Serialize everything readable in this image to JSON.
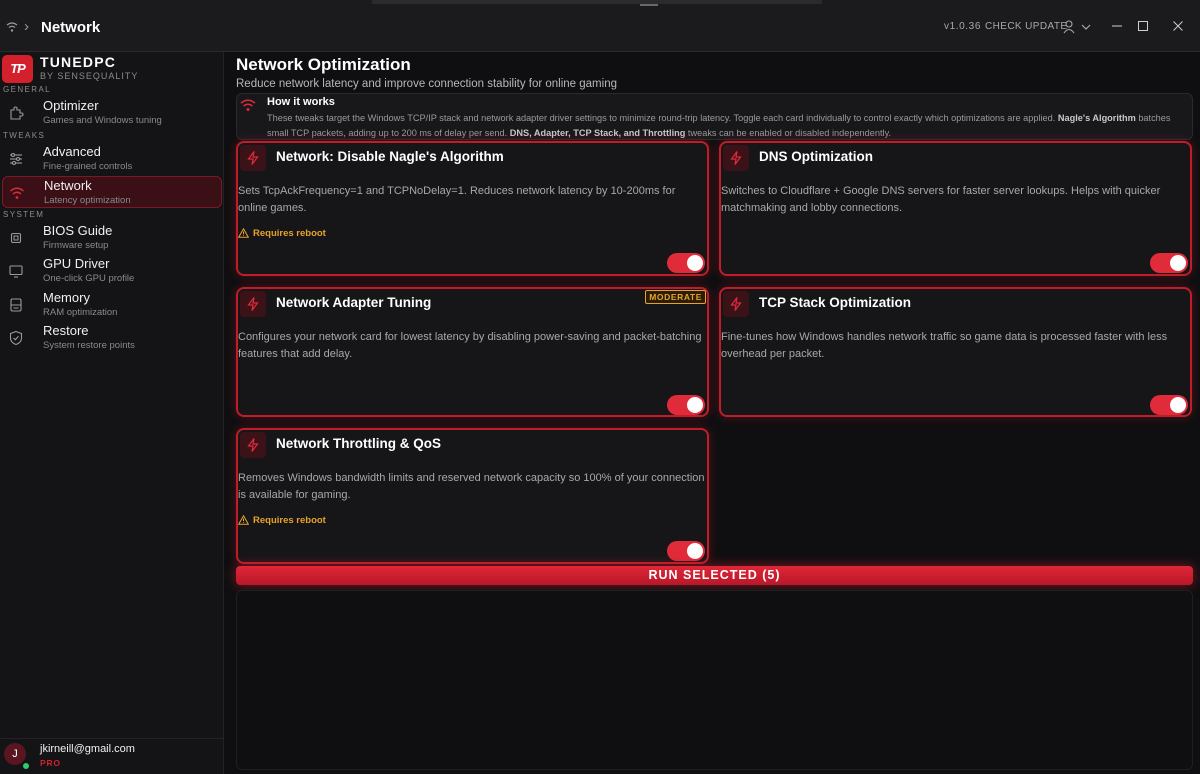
{
  "titlebar": {
    "title": "Network",
    "version": "v1.0.36",
    "check_update": "CHECK UPDATE",
    "icons": [
      "wifi-icon",
      "chevron-right-icon",
      "user-icon",
      "chevron-down-icon",
      "minimize-icon",
      "maximize-icon",
      "close-icon"
    ]
  },
  "brand": {
    "logo_text": "TP",
    "name": "TUNEDPC",
    "tagline": "BY SENSEQUALITY"
  },
  "sidebar": {
    "sections": {
      "general": "GENERAL",
      "tweaks": "TWEAKS",
      "system": "SYSTEM"
    },
    "items": [
      {
        "label": "Optimizer",
        "desc": "Games and Windows tuning",
        "icon": "puzzle-icon"
      },
      {
        "label": "Advanced",
        "desc": "Fine-grained controls",
        "icon": "sliders-icon"
      },
      {
        "label": "Network",
        "desc": "Latency optimization",
        "icon": "wifi-icon",
        "active": true
      },
      {
        "label": "BIOS Guide",
        "desc": "Firmware setup",
        "icon": "chip-icon"
      },
      {
        "label": "GPU Driver",
        "desc": "One-click GPU profile",
        "icon": "monitor-icon"
      },
      {
        "label": "Memory",
        "desc": "RAM optimization",
        "icon": "memory-icon"
      },
      {
        "label": "Restore",
        "desc": "System restore points",
        "icon": "shield-icon"
      }
    ]
  },
  "user": {
    "initial": "J",
    "email": "jkirneill@gmail.com",
    "plan": "PRO"
  },
  "page": {
    "title": "Network Optimization",
    "subtitle": "Reduce network latency and improve connection stability for online gaming"
  },
  "info": {
    "title": "How it works",
    "text_1": "These tweaks target the Windows TCP/IP stack and network adapter driver settings to minimize round-trip latency. Toggle each card individually to control exactly which optimizations are applied. ",
    "bold_1": "Nagle's Algorithm",
    "text_2": " batches small TCP packets, adding up to 200 ms of delay per send. ",
    "bold_2": "DNS, Adapter, TCP Stack, and Throttling",
    "text_3": " tweaks can be enabled or disabled independently."
  },
  "cards": [
    {
      "title": "Network: Disable Nagle's Algorithm",
      "desc": "Sets TcpAckFrequency=1 and TCPNoDelay=1. Reduces network latency by 10-200ms for online games.",
      "warning": "Requires reboot",
      "badge": "",
      "enabled": true
    },
    {
      "title": "DNS Optimization",
      "desc": "Switches to Cloudflare + Google DNS servers for faster server lookups. Helps with quicker matchmaking and lobby connections.",
      "warning": "",
      "badge": "",
      "enabled": true
    },
    {
      "title": "Network Adapter Tuning",
      "desc": "Configures your network card for lowest latency by disabling power-saving and packet-batching features that add delay.",
      "warning": "",
      "badge": "MODERATE",
      "enabled": true
    },
    {
      "title": "TCP Stack Optimization",
      "desc": "Fine-tunes how Windows handles network traffic so game data is processed faster with less overhead per packet.",
      "warning": "",
      "badge": "",
      "enabled": true
    },
    {
      "title": "Network Throttling & QoS",
      "desc": "Removes Windows bandwidth limits and reserved network capacity so 100% of your connection is available for gaming.",
      "warning": "Requires reboot",
      "badge": "",
      "enabled": true
    }
  ],
  "run_button": "RUN SELECTED (5)",
  "colors": {
    "accent": "#e02b3a",
    "warning": "#e8a22a",
    "background": "#0f0f11"
  }
}
